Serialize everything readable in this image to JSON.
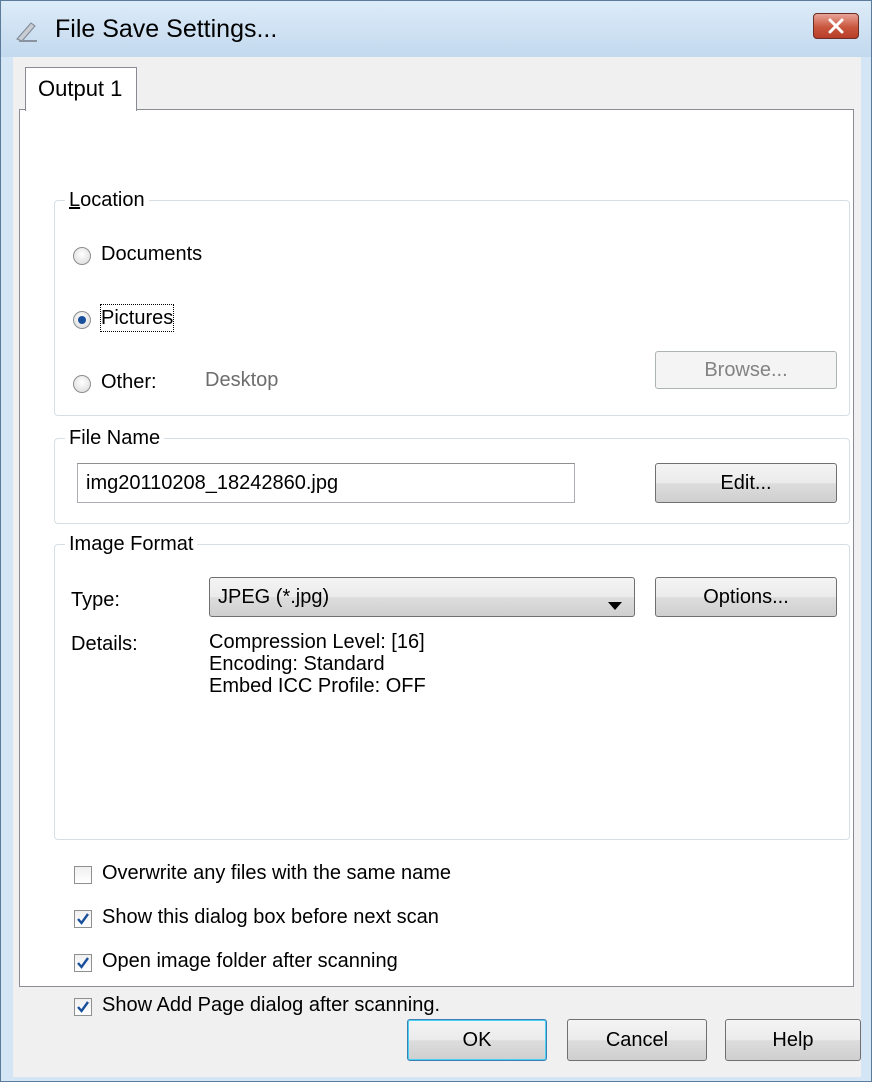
{
  "window": {
    "title": "File Save Settings..."
  },
  "tabs": [
    {
      "label": "Output 1"
    }
  ],
  "location": {
    "group_label": "Location",
    "options": [
      {
        "label": "Documents",
        "checked": false
      },
      {
        "label": "Pictures",
        "checked": true
      },
      {
        "label": "Other:",
        "checked": false
      }
    ],
    "other_path": "Desktop",
    "browse_label": "Browse..."
  },
  "file_name": {
    "group_label": "File Name",
    "value": "img20110208_18242860.jpg",
    "edit_label": "Edit..."
  },
  "image_format": {
    "group_label": "Image Format",
    "type_label": "Type:",
    "type_value": "JPEG (*.jpg)",
    "options_label": "Options...",
    "details_label": "Details:",
    "details": [
      "Compression Level: [16]",
      "Encoding: Standard",
      "Embed ICC Profile: OFF"
    ]
  },
  "checkboxes": [
    {
      "label": "Overwrite any files with the same name",
      "checked": false
    },
    {
      "label": "Show this dialog box before next scan",
      "checked": true
    },
    {
      "label": "Open image folder after scanning",
      "checked": true
    },
    {
      "label": "Show Add Page dialog after scanning.",
      "checked": true
    }
  ],
  "buttons": {
    "ok": "OK",
    "cancel": "Cancel",
    "help": "Help"
  },
  "icons": {
    "app": "scanner-icon",
    "close": "close-icon",
    "dropdown": "chevron-down-icon"
  },
  "colors": {
    "radio_dot": "#1a4f9c",
    "check_mark": "#1a4f9c",
    "close_button": "#c9563e"
  }
}
